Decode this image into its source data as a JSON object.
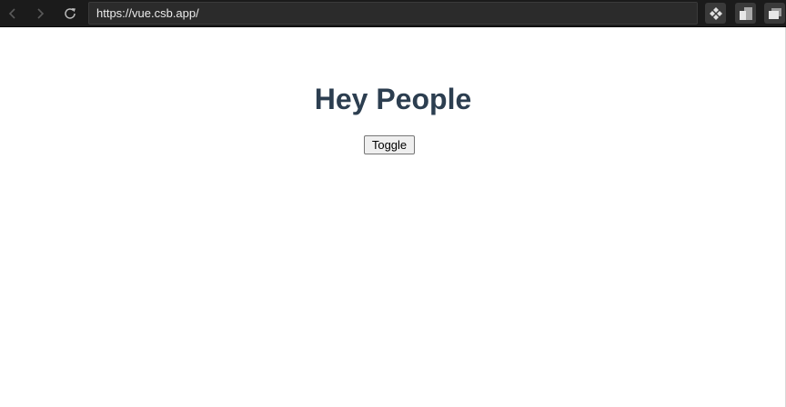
{
  "browser": {
    "url": "https://vue.csb.app/",
    "nav_icons": [
      "back-icon",
      "forward-icon",
      "reload-icon"
    ],
    "toolbar_icons": [
      "extension-icon",
      "panels-icon",
      "windows-icon"
    ]
  },
  "app": {
    "title": "Hey People",
    "toggle_label": "Toggle"
  },
  "colors": {
    "chrome_bg": "#1b1b1b",
    "url_bar_bg": "#2b2b2b",
    "title_color": "#2c3e50",
    "button_bg": "#efefef"
  }
}
